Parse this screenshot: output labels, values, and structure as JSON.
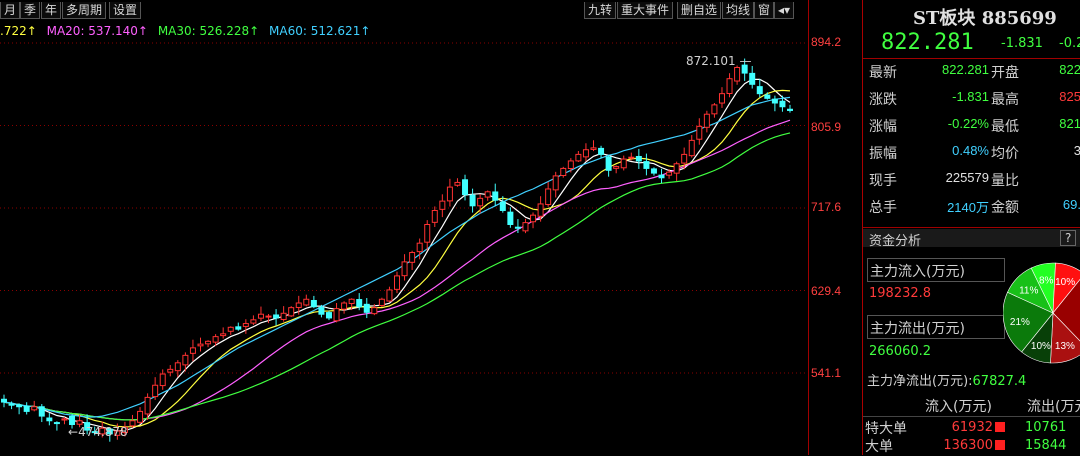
{
  "toolbar": {
    "left_buttons": [
      "月",
      "季",
      "年",
      "多周期",
      "设置"
    ],
    "right_buttons": [
      "九转",
      "重大事件",
      "删自选",
      "均线",
      "窗",
      "◂▾"
    ]
  },
  "ma_legend": [
    {
      "text": ".722↑",
      "color": "#ffff40"
    },
    {
      "text": "MA20: 537.140↑",
      "color": "#ff60ff"
    },
    {
      "text": "MA30: 526.228↑",
      "color": "#40ff40"
    },
    {
      "text": "MA60: 512.621↑",
      "color": "#40d0ff"
    }
  ],
  "price_axis": [
    "894.2",
    "805.9",
    "717.6",
    "629.4",
    "541.1"
  ],
  "annotations": {
    "high": "872.101",
    "low": "474.878"
  },
  "quote": {
    "title": "ST板块",
    "code": "885699",
    "price": "822.281",
    "change": "-1.831",
    "change_pct_partial": "-0.2",
    "rows": [
      {
        "l1": "最新",
        "v1": "822.281",
        "l2": "开盘",
        "v2": "822"
      },
      {
        "l1": "涨跌",
        "v1": "-1.831",
        "l2": "最高",
        "v2": "825"
      },
      {
        "l1": "涨幅",
        "v1": "-0.22%",
        "l2": "最低",
        "v2": "821"
      },
      {
        "l1": "振幅",
        "v1": "0.48%",
        "l2": "均价",
        "v2": "3"
      },
      {
        "l1": "现手",
        "v1": "225579",
        "l2": "量比",
        "v2": ""
      },
      {
        "l1": "总手",
        "v1": "2140万",
        "l2": "金额",
        "v2": "69."
      }
    ]
  },
  "fund": {
    "header": "资金分析",
    "help": "?",
    "inflow_label": "主力流入(万元)",
    "inflow_value": "198232.8",
    "outflow_label": "主力流出(万元)",
    "outflow_value": "266060.2",
    "net_label": "主力净流出(万元):",
    "net_value": "67827.4",
    "pie_labels": [
      "8%",
      "10%",
      "11%",
      "21%",
      "10%",
      "13%"
    ],
    "table_headers": [
      "流入(万元)",
      "流出(万元"
    ],
    "table_rows": [
      {
        "name": "特大单",
        "inflow": "61932",
        "outflow": "10761"
      },
      {
        "name": "大单",
        "inflow": "136300",
        "outflow": "15844"
      }
    ]
  },
  "chart_data": {
    "type": "candlestick",
    "ylim": [
      474.878,
      894.2
    ],
    "y_ticks": [
      894.2,
      805.9,
      717.6,
      629.4,
      541.1
    ],
    "series_names": [
      "MA20",
      "MA30",
      "MA60"
    ],
    "colors": {
      "up": "#ff3232",
      "down": "#40ffff",
      "ma5": "#ffffff",
      "ma10": "#ffff40",
      "ma20": "#ff60ff",
      "ma30": "#40ff40",
      "ma60": "#40d0ff"
    },
    "close": [
      510,
      507,
      505,
      500,
      505,
      495,
      490,
      488,
      492,
      486,
      490,
      480,
      478,
      482,
      476,
      479,
      483,
      490,
      500,
      515,
      528,
      540,
      545,
      552,
      560,
      568,
      572,
      575,
      580,
      583,
      590,
      588,
      594,
      598,
      604,
      602,
      600,
      605,
      611,
      616,
      620,
      612,
      604,
      600,
      610,
      616,
      620,
      612,
      606,
      611,
      620,
      630,
      645,
      660,
      670,
      680,
      700,
      715,
      725,
      740,
      745,
      732,
      720,
      728,
      735,
      726,
      715,
      700,
      696,
      702,
      710,
      722,
      738,
      752,
      760,
      768,
      775,
      780,
      782,
      775,
      758,
      762,
      770,
      772,
      768,
      760,
      755,
      750,
      756,
      765,
      775,
      790,
      805,
      818,
      828,
      840,
      856,
      868,
      862,
      850,
      840,
      835,
      830,
      826,
      822
    ],
    "ma60": [
      510,
      509,
      507,
      506,
      505,
      503,
      501,
      499,
      497,
      496,
      495,
      494,
      494,
      495,
      497,
      499,
      502,
      505,
      508,
      512,
      516,
      520,
      524,
      528,
      533,
      538,
      543,
      548,
      553,
      558,
      563,
      568,
      572,
      576,
      580,
      584,
      588,
      592,
      596,
      600,
      604,
      608,
      612,
      616,
      620,
      624,
      628,
      632,
      636,
      640,
      644,
      648,
      652,
      657,
      662,
      668,
      674,
      680,
      686,
      692,
      697,
      702,
      707,
      712,
      716,
      720,
      724,
      728,
      731,
      735,
      738,
      742,
      746,
      750,
      754,
      758,
      762,
      765,
      768,
      771,
      774,
      776,
      779,
      781,
      784,
      786,
      788,
      790,
      792,
      794,
      796,
      799,
      802,
      805,
      808,
      812,
      816,
      820,
      824,
      828,
      830,
      832,
      834,
      835,
      836
    ]
  }
}
